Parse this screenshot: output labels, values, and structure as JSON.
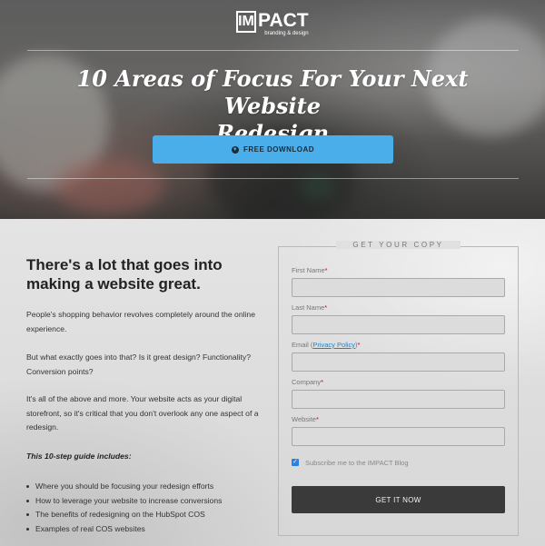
{
  "hero": {
    "logo_mark": "IM",
    "logo_word": "PACT",
    "logo_tagline": "branding & design",
    "title_line1": "10 Areas of Focus For Your Next Website",
    "title_line2": "Redesign",
    "cta_label": "FREE DOWNLOAD",
    "cta_icon": "download-circle-icon"
  },
  "main": {
    "headline_line1": "There's a lot that goes into",
    "headline_line2": "making a website great.",
    "paragraphs": [
      "People's shopping behavior revolves completely around the online experience.",
      "But what exactly goes into that? Is it great design? Functionality? Conversion points?",
      "It's all of the above and more. Your website acts as your digital storefront, so it's critical that you don't overlook any one aspect of a redesign."
    ],
    "guide_title": "This 10-step guide includes:",
    "bullets": [
      "Where you should be focusing your redesign efforts",
      "How to leverage your website to increase conversions",
      "The benefits of redesigning on the HubSpot COS",
      "Examples of real COS websites"
    ]
  },
  "form": {
    "heading": "GET YOUR COPY",
    "fields": [
      {
        "label": "First Name",
        "value": ""
      },
      {
        "label": "Last Name",
        "value": ""
      },
      {
        "label": "Email (",
        "link": "Privacy Policy",
        "suffix": ")",
        "value": ""
      },
      {
        "label": "Company",
        "value": ""
      },
      {
        "label": "Website",
        "value": ""
      }
    ],
    "required_mark": "*",
    "subscribe_label": "Subscribe me to the IMPACT Blog",
    "subscribe_checked": true,
    "submit_label": "GET IT NOW"
  },
  "colors": {
    "cta": "#4aaeea",
    "submit": "#3a3a3a",
    "required": "#d0021b",
    "link": "#2a7fc0"
  }
}
